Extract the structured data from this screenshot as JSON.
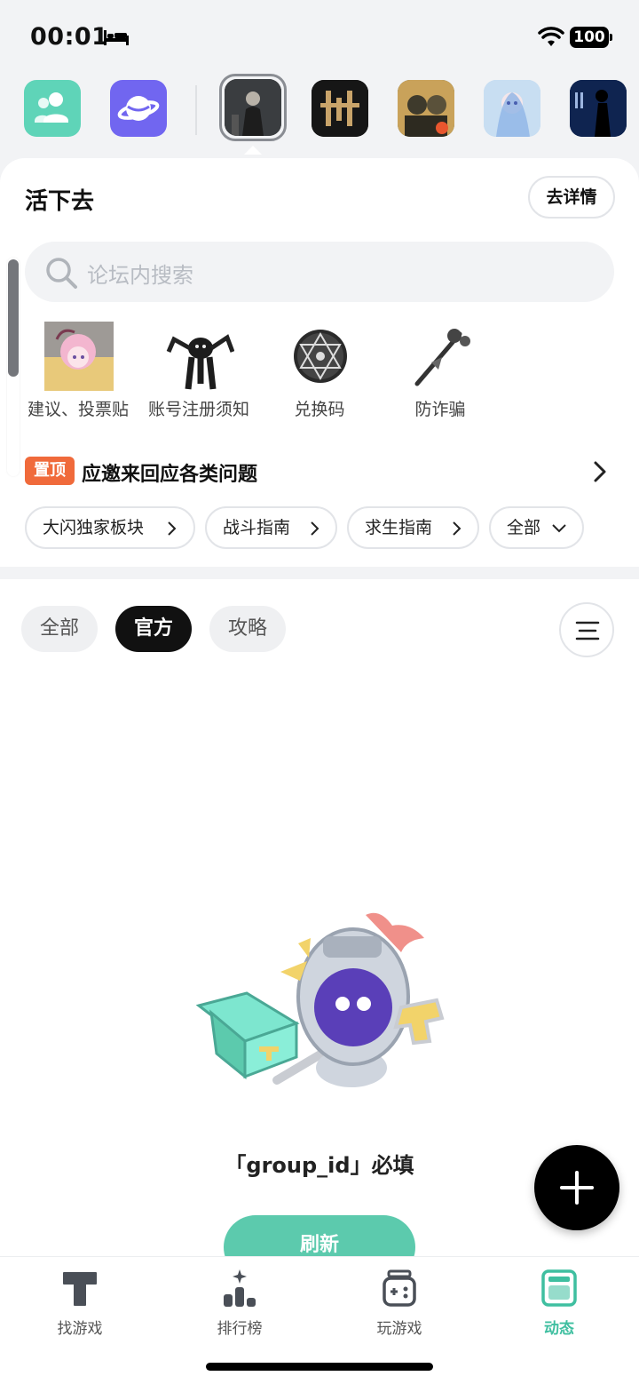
{
  "status_bar": {
    "time": "00:01",
    "battery": "100"
  },
  "app_row": {
    "icons": [
      {
        "name": "friends-app-icon",
        "color": "#5fd4b8"
      },
      {
        "name": "planet-app-icon",
        "color": "#7166f0"
      },
      {
        "name": "survive-game-icon",
        "selected": true
      },
      {
        "name": "game-icon-2"
      },
      {
        "name": "pubg-game-icon"
      },
      {
        "name": "anime-game-icon"
      },
      {
        "name": "code-et-game-icon"
      }
    ]
  },
  "forum": {
    "title": "活下去",
    "detail_label": "去详情",
    "search_placeholder": "论坛内搜索"
  },
  "quick_links": [
    {
      "label": "建议、投票贴"
    },
    {
      "label": "账号注册须知"
    },
    {
      "label": "兑换码"
    },
    {
      "label": "防诈骗"
    }
  ],
  "pinned": {
    "badge": "置顶",
    "text": "应邀来回应各类问题"
  },
  "chips": [
    {
      "label": "大闪独家板块"
    },
    {
      "label": "战斗指南"
    },
    {
      "label": "求生指南"
    },
    {
      "label": "全部"
    }
  ],
  "filters": {
    "tabs": [
      {
        "label": "全部",
        "active": false
      },
      {
        "label": "官方",
        "active": true
      },
      {
        "label": "攻略",
        "active": false
      }
    ]
  },
  "empty_state": {
    "message": "「group_id」必填",
    "refresh_label": "刷新"
  },
  "tab_bar": {
    "items": [
      {
        "label": "找游戏",
        "active": false
      },
      {
        "label": "排行榜",
        "active": false
      },
      {
        "label": "玩游戏",
        "active": false
      },
      {
        "label": "动态",
        "active": true
      }
    ]
  },
  "colors": {
    "accent": "#5ccaad",
    "active_tab": "#3fbfa0",
    "pinned_badge": "#f06a3b"
  }
}
